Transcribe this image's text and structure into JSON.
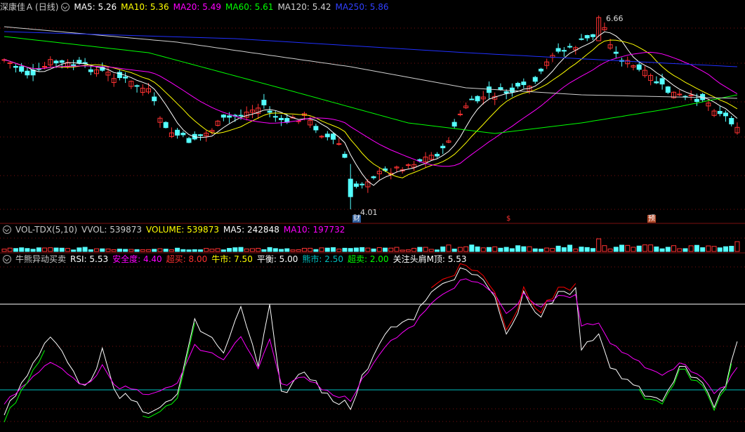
{
  "colors": {
    "up": "#ff3232",
    "down": "#54ffff",
    "grid": "#7a1010",
    "ma5": "#ffffff",
    "ma10": "#ffff00",
    "ma20": "#ff00ff",
    "ma60": "#00ff00",
    "ma120": "#d0d0d0",
    "ma250": "#2030ff",
    "rsi": "#ffffff",
    "safe": "#ff00ff",
    "overbought": "#ff0000",
    "bull": "#ffff00",
    "balance": "#ffffff",
    "bear": "#00c0c0",
    "oversold": "#00ff00",
    "headtop": "#ffffff"
  },
  "main_panel": {
    "stock_name": "深康佳Ａ",
    "period": "(日线)",
    "indicators": [
      {
        "label": "MA5: 5.26",
        "color": "#ffffff"
      },
      {
        "label": "MA10: 5.36",
        "color": "#ffff00"
      },
      {
        "label": "MA20: 5.49",
        "color": "#ff00ff"
      },
      {
        "label": "MA60: 5.61",
        "color": "#00ff00"
      },
      {
        "label": "MA120: 5.42",
        "color": "#d0d0d0"
      },
      {
        "label": "MA250: 5.86",
        "color": "#3040ff"
      }
    ],
    "high_label": "6.66",
    "low_label": "4.01",
    "markers": {
      "cai": "财",
      "dollar": "$",
      "yu": "预"
    }
  },
  "volume_panel": {
    "indicators": [
      {
        "label": "VOL-TDX(5,10)",
        "color": "#c8c8c8"
      },
      {
        "label": "VVOL: 539873",
        "color": "#c8c8c8"
      },
      {
        "label": "VOLUME: 539873",
        "color": "#ffff00"
      },
      {
        "label": "MA5: 242848",
        "color": "#ffffff"
      },
      {
        "label": "MA10: 197732",
        "color": "#ff00ff"
      }
    ]
  },
  "indicator_panel": {
    "indicators": [
      {
        "label": "牛熊异动买卖",
        "color": "#c8c8c8"
      },
      {
        "label": "RSI: 5.53",
        "color": "#ffffff"
      },
      {
        "label": "安全度: 4.40",
        "color": "#ff00ff"
      },
      {
        "label": "超买: 8.00",
        "color": "#ff3030"
      },
      {
        "label": "牛市: 7.50",
        "color": "#ffff00"
      },
      {
        "label": "平衡: 5.00",
        "color": "#ffffff"
      },
      {
        "label": "熊市: 2.50",
        "color": "#00c0c0"
      },
      {
        "label": "超卖: 2.00",
        "color": "#00ff00"
      },
      {
        "label": "关注头肩M顶: 5.53",
        "color": "#ffffff"
      }
    ]
  }
}
